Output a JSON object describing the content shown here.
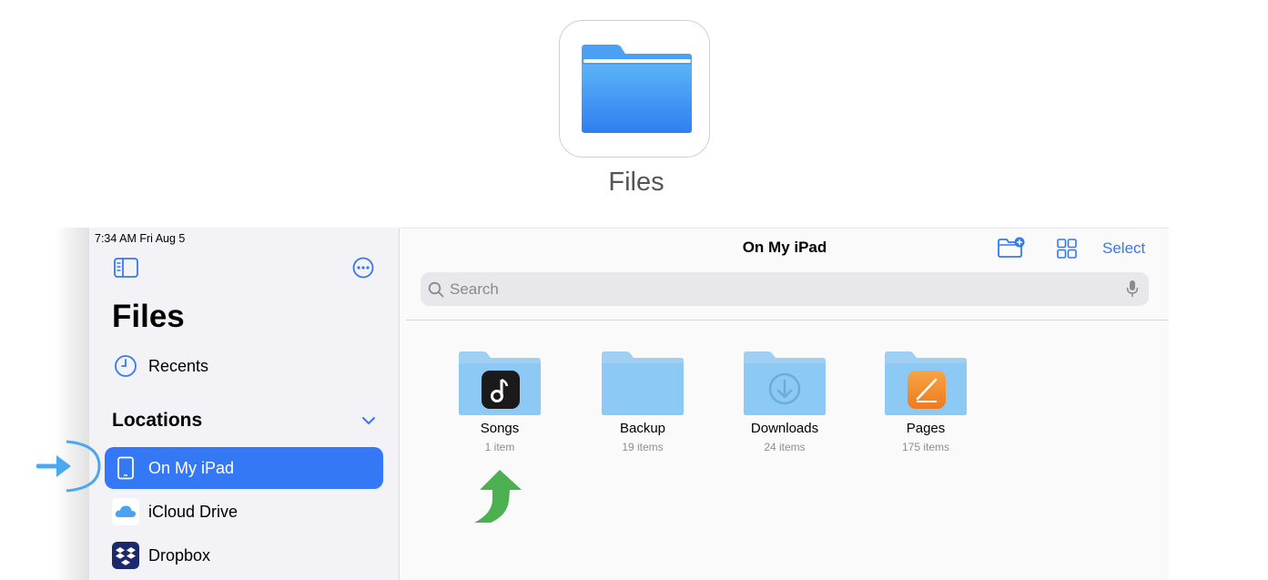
{
  "app_icon": {
    "label": "Files",
    "icon": "folder-icon"
  },
  "status_bar": {
    "time": "7:34 AM   Fri Aug 5"
  },
  "sidebar": {
    "title": "Files",
    "recents": {
      "label": "Recents",
      "icon": "clock-icon"
    },
    "locations_header": "Locations",
    "items": [
      {
        "label": "On My iPad",
        "icon": "ipad-icon",
        "selected": true
      },
      {
        "label": "iCloud Drive",
        "icon": "cloud-icon",
        "selected": false
      },
      {
        "label": "Dropbox",
        "icon": "dropbox-icon",
        "selected": false
      }
    ]
  },
  "main": {
    "title": "On My iPad",
    "select_label": "Select",
    "search": {
      "placeholder": "Search"
    },
    "folders": [
      {
        "name": "Songs",
        "count": "1 item"
      },
      {
        "name": "Backup",
        "count": "19 items"
      },
      {
        "name": "Downloads",
        "count": "24 items"
      },
      {
        "name": "Pages",
        "count": "175 items"
      }
    ]
  },
  "colors": {
    "accent": "#3478f6",
    "folder": "#9fd0f4",
    "annotation_arrow": "#4aa8f0",
    "green_arrow": "#4caf50"
  }
}
